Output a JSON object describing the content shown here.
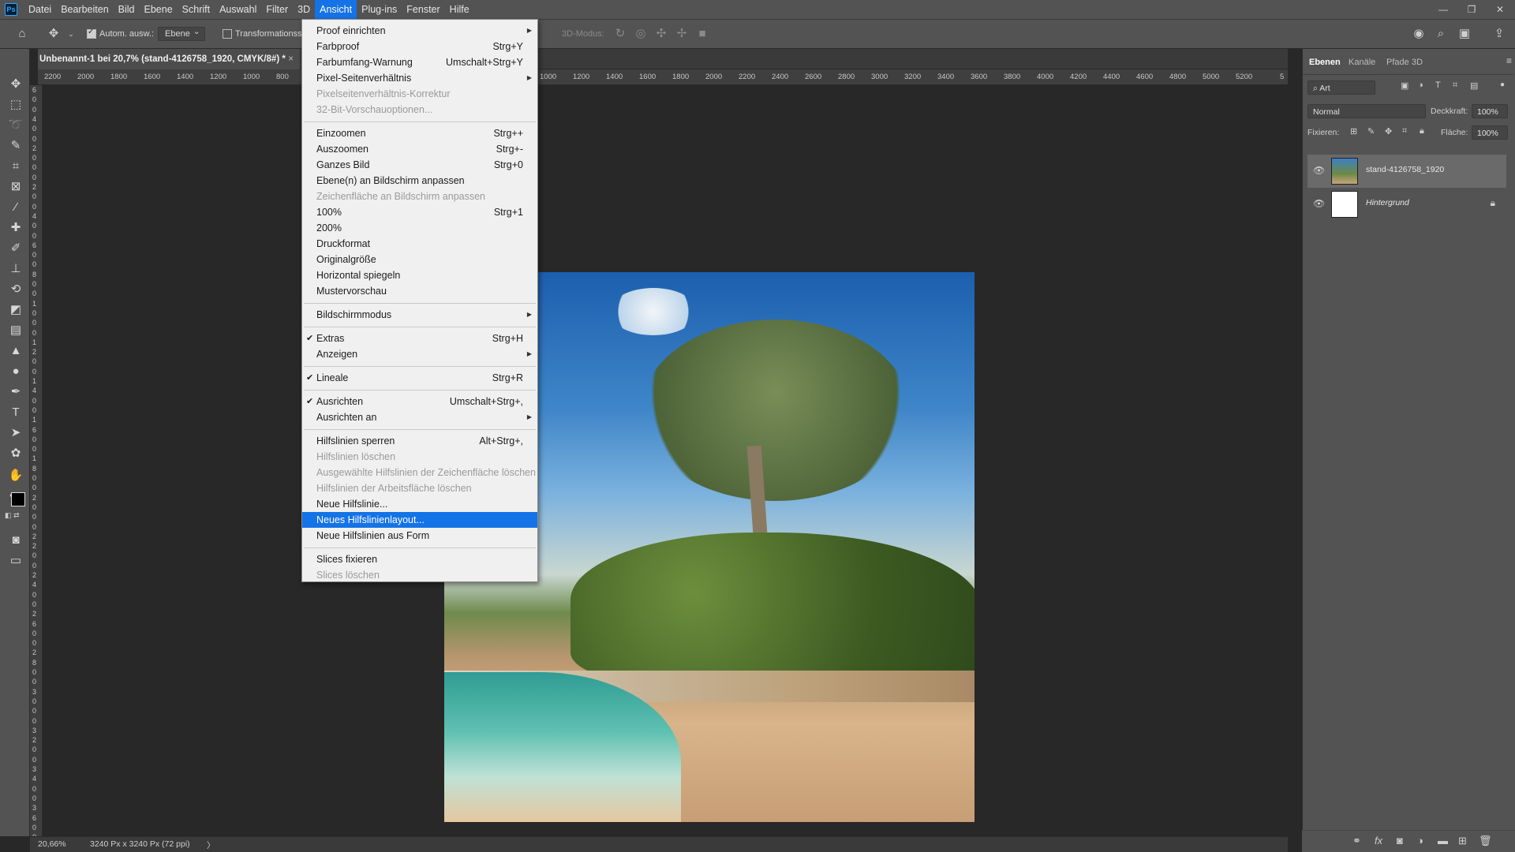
{
  "app": {
    "logo": "Ps"
  },
  "menubar": {
    "items": [
      "Datei",
      "Bearbeiten",
      "Bild",
      "Ebene",
      "Schrift",
      "Auswahl",
      "Filter",
      "3D",
      "Ansicht",
      "Plug-ins",
      "Fenster",
      "Hilfe"
    ],
    "active": "Ansicht"
  },
  "window_controls": {
    "minimize": "—",
    "restore": "❐",
    "close": "✕"
  },
  "optionsbar": {
    "auto_select_label": "Autom. ausw.:",
    "auto_select_value": "Ebene",
    "transform_label": "Transformationsstrg.",
    "mode_3d_label": "3D-Modus:"
  },
  "document": {
    "tab_title": "Unbenannt-1 bei 20,7% (stand-4126758_1920, CMYK/8#) *",
    "close": "×"
  },
  "ruler_top_labels": [
    "2200",
    "2000",
    "1800",
    "1600",
    "1400",
    "1200",
    "1000",
    "800",
    "00",
    "1000",
    "1200",
    "1400",
    "1600",
    "1800",
    "2000",
    "2200",
    "2400",
    "2600",
    "2800",
    "3000",
    "3200",
    "3400",
    "3600",
    "3800",
    "4000",
    "4200",
    "4400",
    "4600",
    "4800",
    "5000",
    "5200",
    "5"
  ],
  "ruler_left_labels": [
    "6",
    "0",
    "0",
    "4",
    "0",
    "0",
    "2",
    "0",
    "0",
    "0",
    "2",
    "0",
    "0",
    "4",
    "0",
    "0",
    "6",
    "0",
    "0",
    "8",
    "0",
    "0",
    "1",
    "0",
    "0",
    "0",
    "1",
    "2",
    "0",
    "0",
    "1",
    "4",
    "0",
    "0",
    "1",
    "6",
    "0",
    "0",
    "1",
    "8",
    "0",
    "0",
    "2",
    "0",
    "0",
    "0",
    "2",
    "2",
    "0",
    "0",
    "2",
    "4",
    "0",
    "0",
    "2",
    "6",
    "0",
    "0",
    "2",
    "8",
    "0",
    "0",
    "3",
    "0",
    "0",
    "0",
    "3",
    "2",
    "0",
    "0",
    "3",
    "4",
    "0",
    "0",
    "3",
    "6",
    "0",
    "0"
  ],
  "ansicht_menu": {
    "items": [
      {
        "label": "Proof einrichten",
        "shortcut": "",
        "submenu": true,
        "disabled": false,
        "checked": false
      },
      {
        "label": "Farbproof",
        "shortcut": "Strg+Y",
        "submenu": false,
        "disabled": false,
        "checked": false
      },
      {
        "label": "Farbumfang-Warnung",
        "shortcut": "Umschalt+Strg+Y",
        "submenu": false,
        "disabled": false,
        "checked": false
      },
      {
        "label": "Pixel-Seitenverhältnis",
        "shortcut": "",
        "submenu": true,
        "disabled": false,
        "checked": false
      },
      {
        "label": "Pixelseitenverhältnis-Korrektur",
        "shortcut": "",
        "submenu": false,
        "disabled": true,
        "checked": false
      },
      {
        "label": "32-Bit-Vorschauoptionen...",
        "shortcut": "",
        "submenu": false,
        "disabled": true,
        "checked": false
      },
      {
        "separator": true
      },
      {
        "label": "Einzoomen",
        "shortcut": "Strg++",
        "submenu": false,
        "disabled": false,
        "checked": false
      },
      {
        "label": "Auszoomen",
        "shortcut": "Strg+-",
        "submenu": false,
        "disabled": false,
        "checked": false
      },
      {
        "label": "Ganzes Bild",
        "shortcut": "Strg+0",
        "submenu": false,
        "disabled": false,
        "checked": false
      },
      {
        "label": "Ebene(n) an Bildschirm anpassen",
        "shortcut": "",
        "submenu": false,
        "disabled": false,
        "checked": false
      },
      {
        "label": "Zeichenfläche an Bildschirm anpassen",
        "shortcut": "",
        "submenu": false,
        "disabled": true,
        "checked": false
      },
      {
        "label": "100%",
        "shortcut": "Strg+1",
        "submenu": false,
        "disabled": false,
        "checked": false
      },
      {
        "label": "200%",
        "shortcut": "",
        "submenu": false,
        "disabled": false,
        "checked": false
      },
      {
        "label": "Druckformat",
        "shortcut": "",
        "submenu": false,
        "disabled": false,
        "checked": false
      },
      {
        "label": "Originalgröße",
        "shortcut": "",
        "submenu": false,
        "disabled": false,
        "checked": false
      },
      {
        "label": "Horizontal spiegeln",
        "shortcut": "",
        "submenu": false,
        "disabled": false,
        "checked": false
      },
      {
        "label": "Mustervorschau",
        "shortcut": "",
        "submenu": false,
        "disabled": false,
        "checked": false
      },
      {
        "separator": true
      },
      {
        "label": "Bildschirmmodus",
        "shortcut": "",
        "submenu": true,
        "disabled": false,
        "checked": false
      },
      {
        "separator": true
      },
      {
        "label": "Extras",
        "shortcut": "Strg+H",
        "submenu": false,
        "disabled": false,
        "checked": true
      },
      {
        "label": "Anzeigen",
        "shortcut": "",
        "submenu": true,
        "disabled": false,
        "checked": false
      },
      {
        "separator": true
      },
      {
        "label": "Lineale",
        "shortcut": "Strg+R",
        "submenu": false,
        "disabled": false,
        "checked": true
      },
      {
        "separator": true
      },
      {
        "label": "Ausrichten",
        "shortcut": "Umschalt+Strg+,",
        "submenu": false,
        "disabled": false,
        "checked": true
      },
      {
        "label": "Ausrichten an",
        "shortcut": "",
        "submenu": true,
        "disabled": false,
        "checked": false
      },
      {
        "separator": true
      },
      {
        "label": "Hilfslinien sperren",
        "shortcut": "Alt+Strg+,",
        "submenu": false,
        "disabled": false,
        "checked": false
      },
      {
        "label": "Hilfslinien löschen",
        "shortcut": "",
        "submenu": false,
        "disabled": true,
        "checked": false
      },
      {
        "label": "Ausgewählte Hilfslinien der Zeichenfläche löschen",
        "shortcut": "",
        "submenu": false,
        "disabled": true,
        "checked": false
      },
      {
        "label": "Hilfslinien der Arbeitsfläche löschen",
        "shortcut": "",
        "submenu": false,
        "disabled": true,
        "checked": false
      },
      {
        "label": "Neue Hilfslinie...",
        "shortcut": "",
        "submenu": false,
        "disabled": false,
        "checked": false
      },
      {
        "label": "Neues Hilfslinienlayout...",
        "shortcut": "",
        "submenu": false,
        "disabled": false,
        "checked": false,
        "highlighted": true
      },
      {
        "label": "Neue Hilfslinien aus Form",
        "shortcut": "",
        "submenu": false,
        "disabled": false,
        "checked": false
      },
      {
        "separator": true
      },
      {
        "label": "Slices fixieren",
        "shortcut": "",
        "submenu": false,
        "disabled": false,
        "checked": false
      },
      {
        "label": "Slices löschen",
        "shortcut": "",
        "submenu": false,
        "disabled": true,
        "checked": false
      }
    ]
  },
  "panel": {
    "tabs": [
      "Ebenen",
      "Kanäle",
      "Pfade",
      "3D"
    ],
    "active_tab": "Ebenen",
    "filter_label": "Art",
    "blend_mode": "Normal",
    "opacity_label": "Deckkraft:",
    "opacity_value": "100%",
    "lock_label": "Fixieren:",
    "fill_label": "Fläche:",
    "fill_value": "100%",
    "layers": [
      {
        "name": "stand-4126758_1920",
        "selected": true,
        "locked": false
      },
      {
        "name": "Hintergrund",
        "selected": false,
        "locked": true
      }
    ]
  },
  "statusbar": {
    "zoom": "20,66%",
    "doc_size": "3240 Px x 3240 Px (72 ppi)",
    "arrow": "〉"
  },
  "colors": {
    "accent": "#1473e6",
    "chrome": "#535353",
    "canvas": "#282828",
    "menu_bg": "#f0f0f0"
  }
}
